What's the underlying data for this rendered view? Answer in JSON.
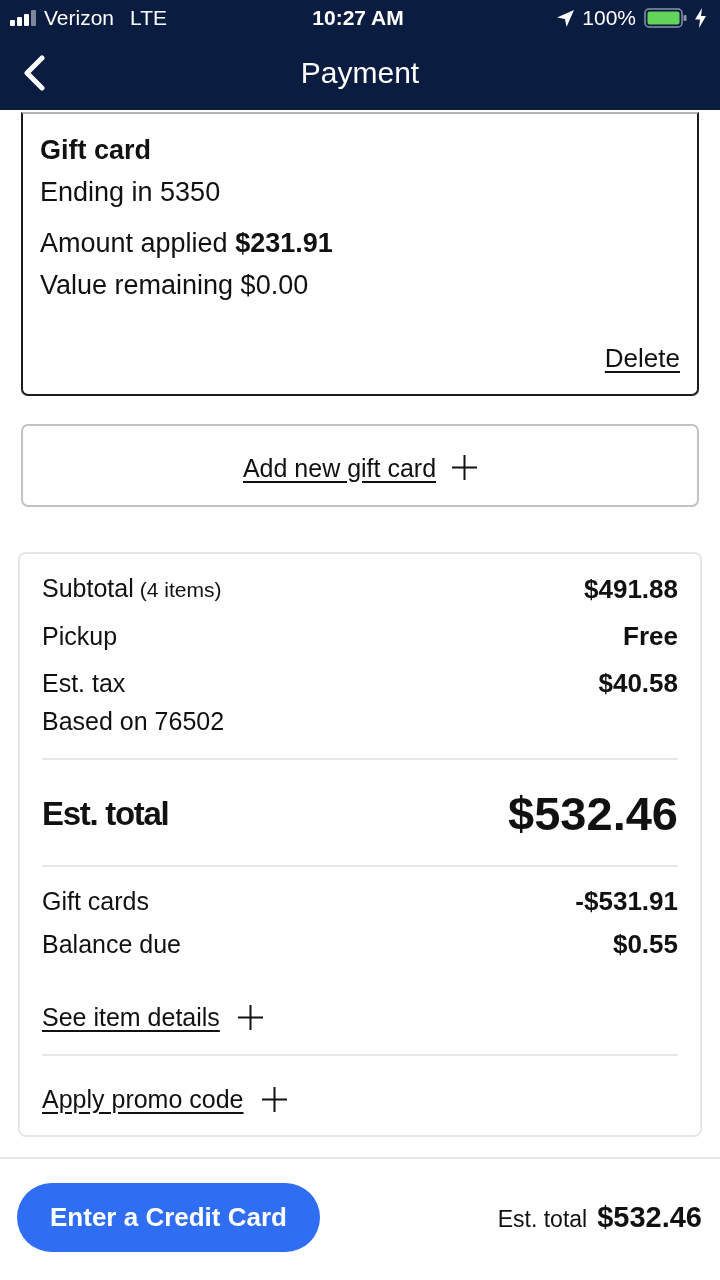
{
  "status_bar": {
    "carrier": "Verizon",
    "network": "LTE",
    "time": "10:27 AM",
    "battery": "100%"
  },
  "header": {
    "title": "Payment"
  },
  "gift_card": {
    "title": "Gift card",
    "ending": "Ending in 5350",
    "amount_applied": "Amount applied **$231.91**",
    "value_remaining": "Value remaining $0.00",
    "delete": "Delete"
  },
  "add_gift_card": {
    "label": "Add new gift card"
  },
  "summary": {
    "rows": [
      {
        "label": "Subtotal",
        "note": "(4 items)",
        "value": "$491.88"
      },
      {
        "label": "Pickup",
        "value": "Free"
      },
      {
        "label": "Est. tax",
        "value": "$40.58",
        "sub": "Based on 76502"
      }
    ],
    "total": {
      "label": "Est. total",
      "value": "$532.46"
    },
    "payments": [
      {
        "label": "Gift cards",
        "value": "-$531.91"
      },
      {
        "label": "Balance due",
        "value": "$0.55"
      }
    ],
    "links": [
      {
        "label": "See item details"
      },
      {
        "label": "Apply promo code"
      }
    ]
  },
  "footer": {
    "button": "Enter a Credit Card",
    "total_label": "Est. total",
    "total_value": "$532.46"
  }
}
